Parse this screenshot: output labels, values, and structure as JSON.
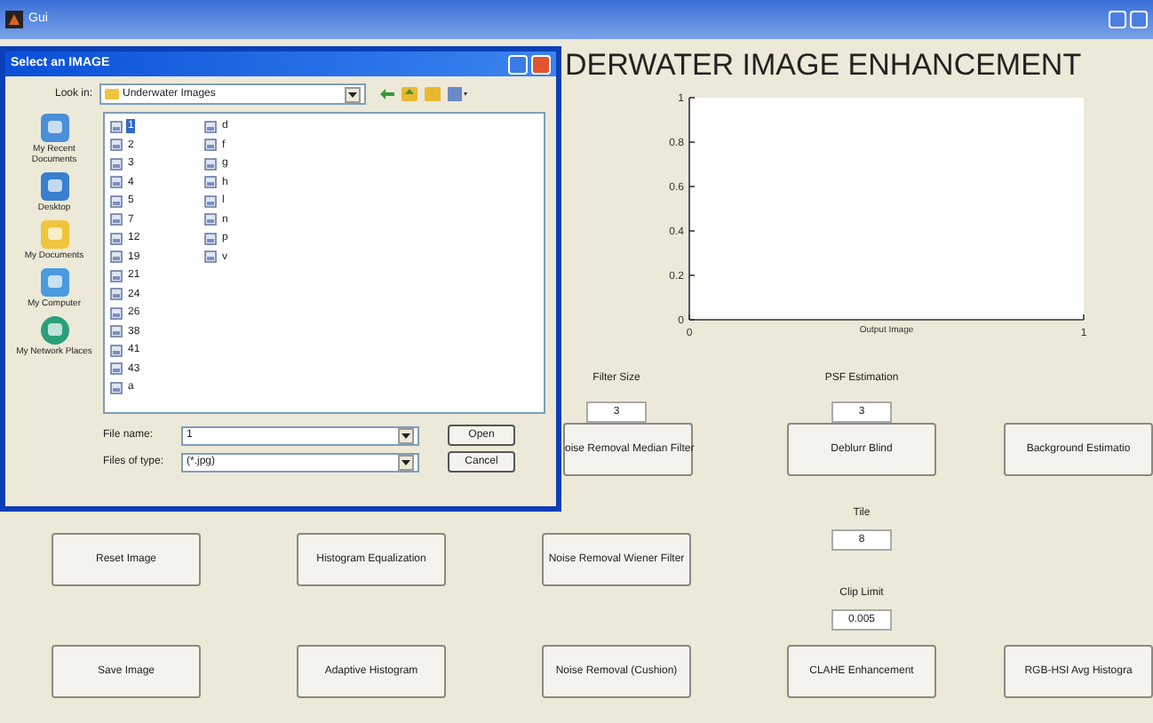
{
  "window": {
    "title": "Gui"
  },
  "heading": "DERWATER IMAGE ENHANCEMENT",
  "chart": {
    "chart_data": {
      "type": "line",
      "xlabel": "Output Image",
      "xlim": [
        0,
        1
      ],
      "ylim": [
        0,
        1
      ],
      "xticks": [
        0,
        1
      ],
      "yticks": [
        0,
        0.2,
        0.4,
        0.6,
        0.8,
        1
      ]
    }
  },
  "panel": {
    "filter_size_label": "Filter Size",
    "filter_size": "3",
    "psf_label": "PSF Estimation",
    "psf": "3",
    "tile_label": "Tile",
    "tile": "8",
    "clip_label": "Clip Limit",
    "clip": "0.005"
  },
  "buttons": [
    "oise Removal Median Filter",
    "Deblurr Blind",
    "Background Estimatio",
    "Reset Image",
    "Histogram Equalization",
    "Noise Removal Wiener Filter",
    "Save Image",
    "Adaptive Histogram",
    "Noise Removal (Cushion)",
    "CLAHE Enhancement",
    "RGB-HSI Avg Histogra"
  ],
  "dialog": {
    "title": "Select an IMAGE",
    "look_in_label": "Look in:",
    "look_in": "Underwater Images",
    "places": [
      "My Recent Documents",
      "Desktop",
      "My Documents",
      "My Computer",
      "My Network Places"
    ],
    "files": [
      {
        "name": "1",
        "selected": true
      },
      {
        "name": "2",
        "selected": false
      },
      {
        "name": "3",
        "selected": false
      },
      {
        "name": "4",
        "selected": false
      },
      {
        "name": "5",
        "selected": false
      },
      {
        "name": "7",
        "selected": false
      },
      {
        "name": "12",
        "selected": false
      },
      {
        "name": "19",
        "selected": false
      },
      {
        "name": "21",
        "selected": false
      },
      {
        "name": "24",
        "selected": false
      },
      {
        "name": "26",
        "selected": false
      },
      {
        "name": "38",
        "selected": false
      },
      {
        "name": "41",
        "selected": false
      },
      {
        "name": "43",
        "selected": false
      },
      {
        "name": "a",
        "selected": false
      },
      {
        "name": "d",
        "selected": false
      },
      {
        "name": "f",
        "selected": false
      },
      {
        "name": "g",
        "selected": false
      },
      {
        "name": "h",
        "selected": false
      },
      {
        "name": "l",
        "selected": false
      },
      {
        "name": "n",
        "selected": false
      },
      {
        "name": "p",
        "selected": false
      },
      {
        "name": "v",
        "selected": false
      }
    ],
    "file_name_label": "File name:",
    "file_name": "1",
    "file_type_label": "Files of type:",
    "file_type": "(*.jpg)",
    "open": "Open",
    "cancel": "Cancel"
  }
}
